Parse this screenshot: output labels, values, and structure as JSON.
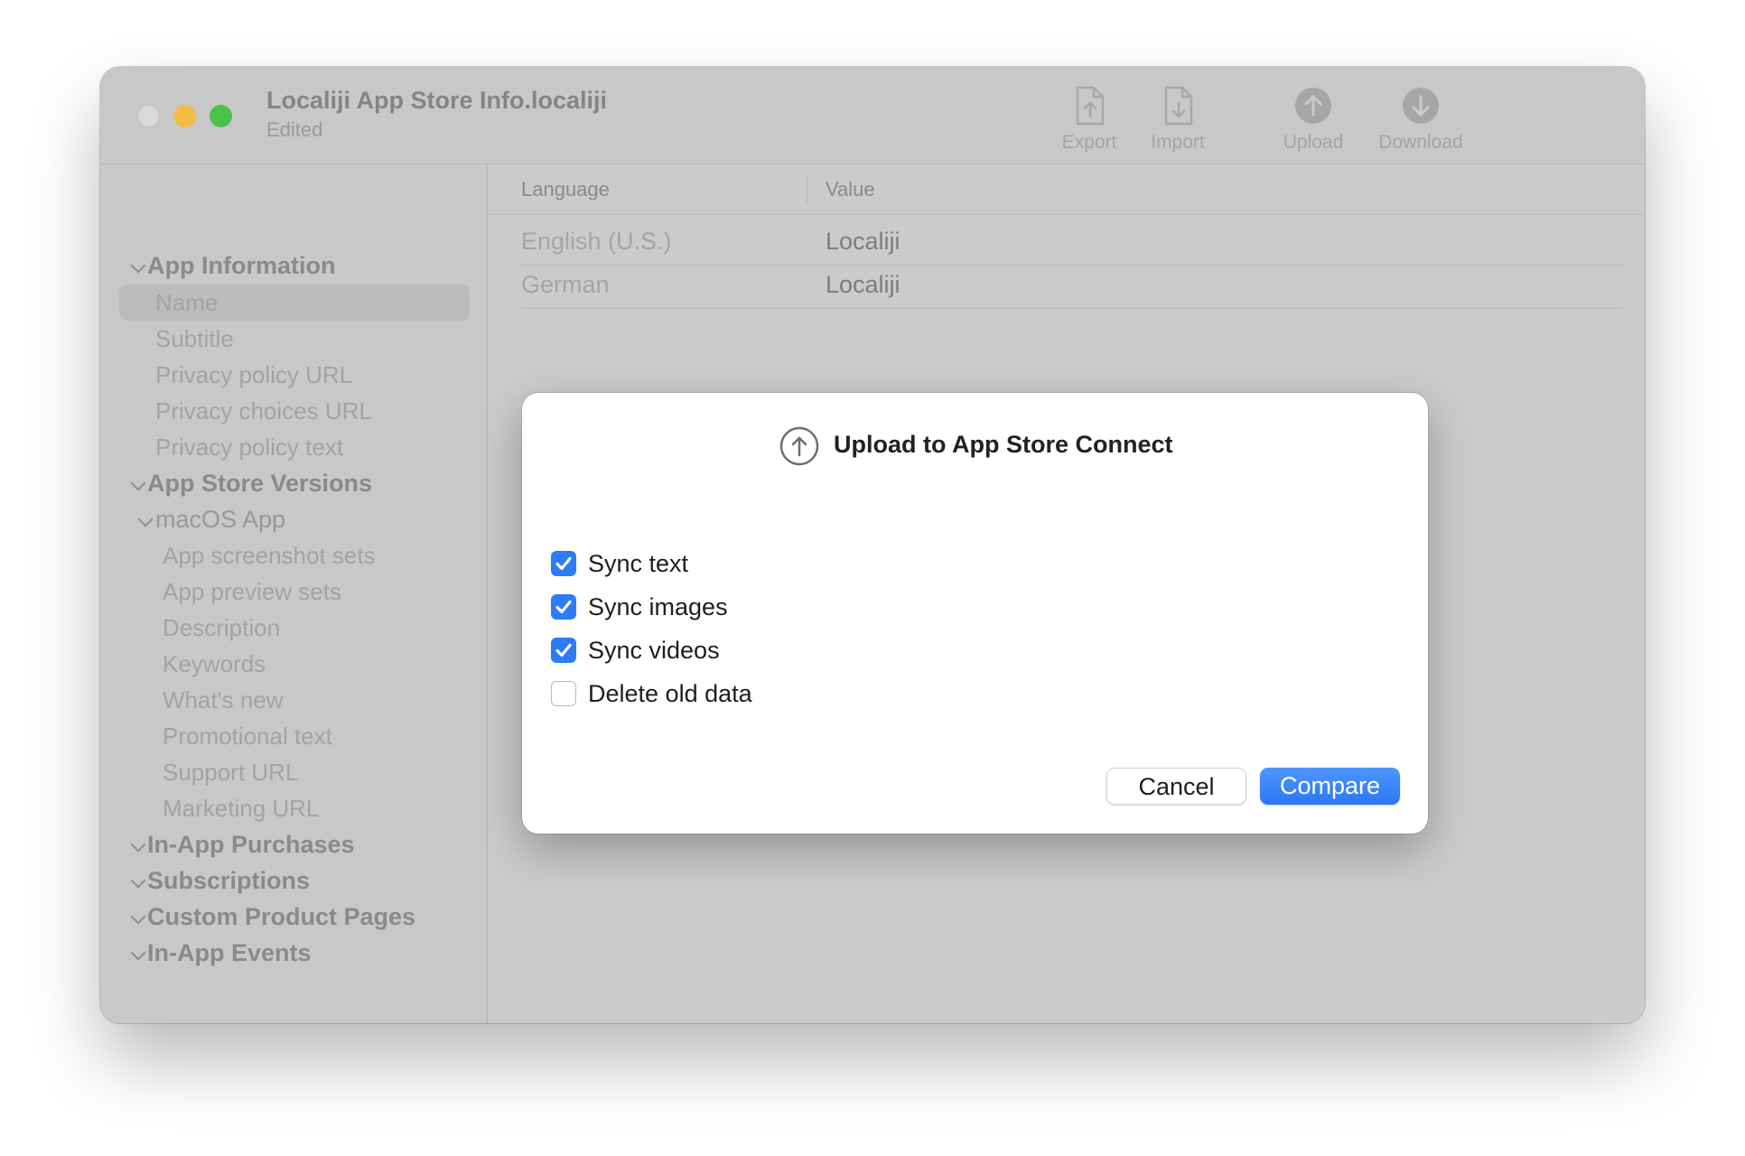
{
  "window": {
    "title": "Localiji App Store Info.localiji",
    "subtitle": "Edited"
  },
  "toolbar": {
    "export_label": "Export",
    "import_label": "Import",
    "upload_label": "Upload",
    "download_label": "Download"
  },
  "sidebar": {
    "groups": {
      "app_information": "App Information",
      "app_store_versions": "App Store Versions",
      "in_app_purchases": "In-App Purchases",
      "subscriptions": "Subscriptions",
      "custom_product_pages": "Custom Product Pages",
      "in_app_events": "In-App Events"
    },
    "app_information_items": [
      "Name",
      "Subtitle",
      "Privacy policy URL",
      "Privacy choices URL",
      "Privacy policy text"
    ],
    "macos_app_label": "macOS App",
    "macos_items": [
      "App screenshot sets",
      "App preview sets",
      "Description",
      "Keywords",
      "What's new",
      "Promotional text",
      "Support URL",
      "Marketing URL"
    ],
    "selected_item": "Name"
  },
  "table": {
    "headers": [
      "Language",
      "Value"
    ],
    "rows": [
      {
        "language": "English (U.S.)",
        "value": "Localiji"
      },
      {
        "language": "German",
        "value": "Localiji"
      }
    ]
  },
  "dialog": {
    "title": "Upload to App Store Connect",
    "options": [
      {
        "label": "Sync text",
        "checked": true
      },
      {
        "label": "Sync images",
        "checked": true
      },
      {
        "label": "Sync videos",
        "checked": true
      },
      {
        "label": "Delete old data",
        "checked": false
      }
    ],
    "cancel_label": "Cancel",
    "compare_label": "Compare"
  },
  "colors": {
    "accent": "#2d7cf6",
    "traffic_close": "#d9d9d9",
    "traffic_minimize": "#f3bd45",
    "traffic_maximize": "#4cc14b"
  },
  "icons": {
    "export": "document-arrow-up-icon",
    "import": "document-arrow-down-icon",
    "upload": "circle-arrow-up-icon",
    "download": "circle-arrow-down-icon",
    "dialog": "circle-arrow-up-icon",
    "checkbox": "checkmark-icon",
    "disclosure": "chevron-down-icon"
  }
}
